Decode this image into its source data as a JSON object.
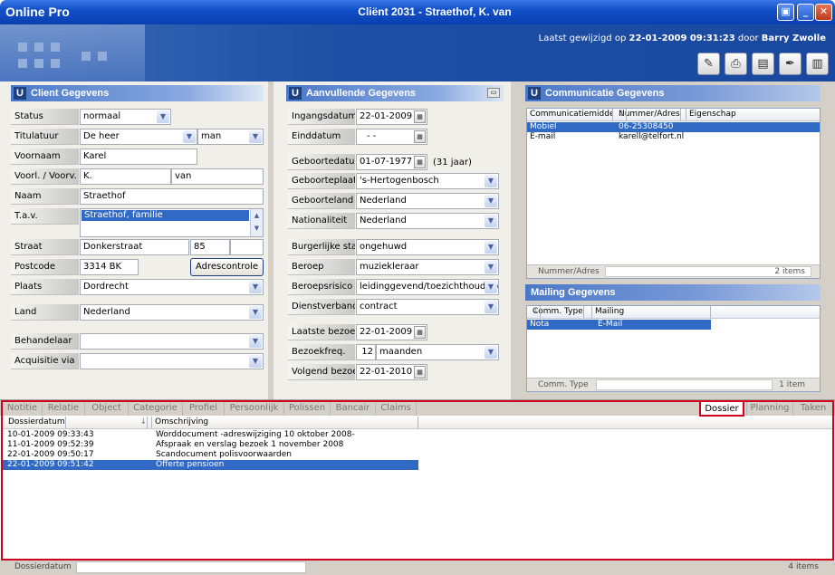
{
  "window": {
    "app_name": "Online Pro",
    "title": "Cliënt 2031  -  Straethof, K. van"
  },
  "header": {
    "lastmod_prefix": "Laatst gewijzigd op",
    "lastmod_date": "22-01-2009 09:31:23",
    "lastmod_mid": "door",
    "lastmod_user": "Barry Zwolle"
  },
  "client": {
    "title": "Client Gegevens",
    "labels": {
      "status": "Status",
      "titulatuur": "Titulatuur",
      "voornaam": "Voornaam",
      "voorl": "Voorl. / Voorv.",
      "naam": "Naam",
      "tav": "T.a.v.",
      "straat": "Straat",
      "postcode": "Postcode",
      "plaats": "Plaats",
      "land": "Land",
      "behandelaar": "Behandelaar",
      "acquisitie": "Acquisitie via"
    },
    "status": "normaal",
    "titulatuur": "De heer",
    "geslacht": "man",
    "voornaam": "Karel",
    "voorletters": "K.",
    "voorvoegsel": "van",
    "naam": "Straethof",
    "tav": "Straethof,  familie",
    "straat": "Donkerstraat",
    "huisnummer": "85",
    "toevoeging": "",
    "postcode": "3314 BK",
    "adrescontrole": "Adrescontrole",
    "plaats": "Dordrecht",
    "land": "Nederland",
    "behandelaar": "",
    "acquisitie": ""
  },
  "extra": {
    "title": "Aanvullende Gegevens",
    "labels": {
      "ingangsdatum": "Ingangsdatum",
      "einddatum": "Einddatum",
      "geboortedatum": "Geboortedatum",
      "geboorteplaats": "Geboorteplaats",
      "geboorteland": "Geboorteland",
      "nationaliteit": "Nationaliteit",
      "burgerlijke_staat": "Burgerlijke staat",
      "beroep": "Beroep",
      "beroepsrisico": "Beroepsrisico",
      "dienstverband": "Dienstverband",
      "laatste_bezoek": "Laatste bezoek",
      "bezoekfreq": "Bezoekfreq.",
      "volgend_bezoek": "Volgend bezoek"
    },
    "ingangsdatum": "22-01-2009",
    "einddatum": "- -",
    "geboortedatum": "01-07-1977",
    "leeftijd": "(31 jaar)",
    "geboorteplaats": "'s-Hertogenbosch",
    "geboorteland": "Nederland",
    "nationaliteit": "Nederland",
    "burgerlijke_staat": "ongehuwd",
    "beroep": "muziekleraar",
    "beroepsrisico": "leidinggevend/toezichthoudend",
    "dienstverband": "contract",
    "laatste_bezoek": "22-01-2009",
    "bezoekfreq_num": "12",
    "bezoekfreq_unit": "maanden",
    "volgend_bezoek": "22-01-2010"
  },
  "communicatie": {
    "title": "Communicatie Gegevens",
    "columns": [
      "Communicatiemiddel",
      "Nummer/Adres",
      "Eigenschap"
    ],
    "rows": [
      [
        "Mobiel",
        "06-25308450",
        ""
      ],
      [
        "E-mail",
        "karell@telfort.nl",
        ""
      ]
    ],
    "footer_label": "Nummer/Adres",
    "footer_count": "2 items"
  },
  "mailing": {
    "title": "Mailing Gegevens",
    "columns": [
      "Comm. Type",
      "Mailing"
    ],
    "rows": [
      [
        "Nota",
        "E-Mail"
      ]
    ],
    "footer_label": "Comm. Type",
    "footer_count": "1 item"
  },
  "tabs": {
    "left": [
      "Notitie",
      "Relatie",
      "Object",
      "Categorie",
      "Profiel",
      "Persoonlijk",
      "Polissen",
      "Bancair",
      "Claims"
    ],
    "right": [
      "Dossier",
      "Planning",
      "Taken"
    ]
  },
  "dossier": {
    "columns": [
      "Dossierdatum",
      "Omschrijving"
    ],
    "rows": [
      [
        "10-01-2009 09:33:43",
        "Worddocument -adreswijziging 10 oktober 2008-"
      ],
      [
        "11-01-2009 09:52:39",
        "Afspraak en verslag bezoek 1 november 2008"
      ],
      [
        "22-01-2009 09:50:17",
        "Scandocument polisvoorwaarden"
      ],
      [
        "22-01-2009 09:51:42",
        "Offerte pensioen"
      ]
    ],
    "footer_label": "Dossierdatum",
    "footer_count": "4 items"
  }
}
